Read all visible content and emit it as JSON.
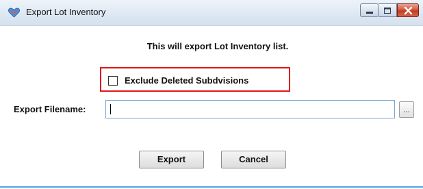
{
  "window": {
    "title": "Export Lot Inventory",
    "icon": "app-heart-icon",
    "controls": [
      "minimize-icon",
      "maximize-icon",
      "close-icon"
    ]
  },
  "dialog": {
    "message": "This will export Lot Inventory list.",
    "exclude_checkbox": {
      "label": "Exclude Deleted Subdvisions",
      "checked": false
    },
    "filename": {
      "label": "Export Filename:",
      "value": "",
      "browse_label": "..."
    },
    "buttons": {
      "export": "Export",
      "cancel": "Cancel"
    }
  },
  "colors": {
    "highlight": "#e01818",
    "titlebar": "#dbe6f2",
    "close_button": "#c9452a",
    "input_border": "#7aa3d6"
  }
}
